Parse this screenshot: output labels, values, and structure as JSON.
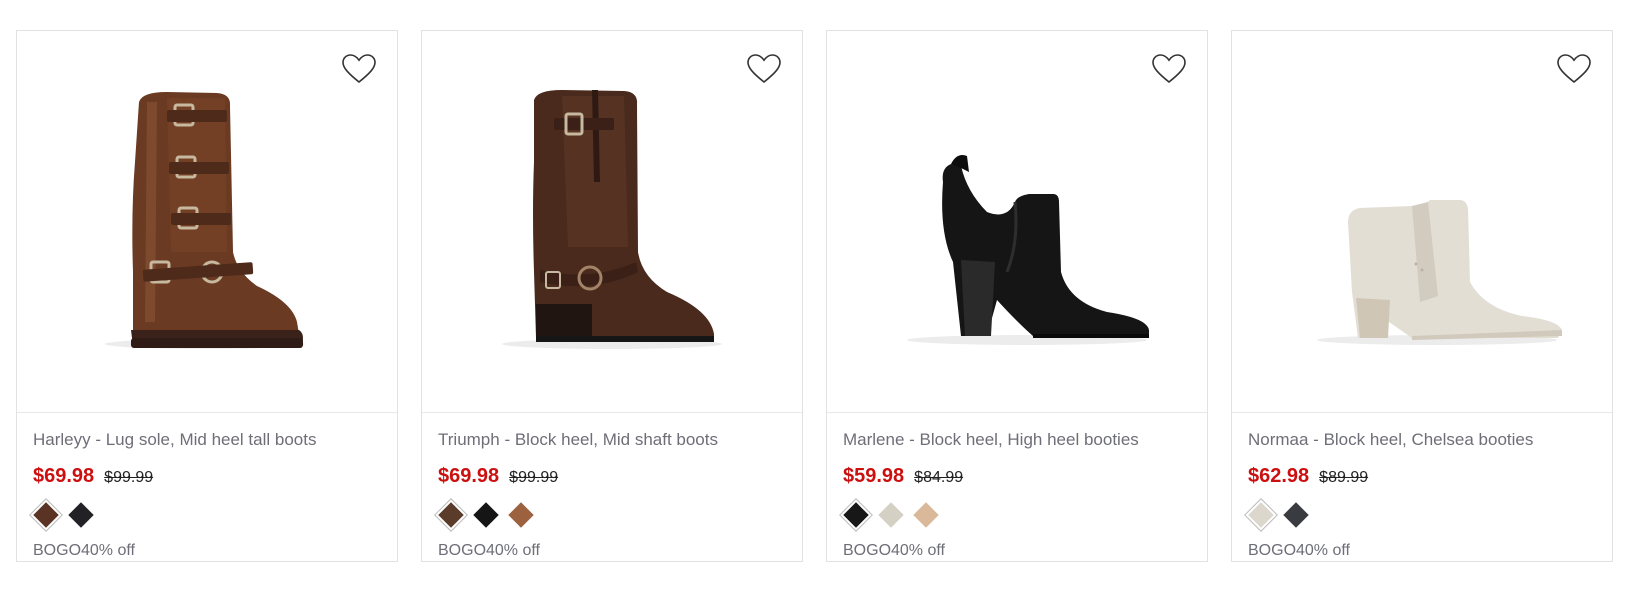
{
  "products": [
    {
      "name": "Harleyy - Lug sole, Mid heel tall boots",
      "sale_price": "$69.98",
      "original_price": "$99.99",
      "swatches": [
        "#5a3324",
        "#222226"
      ],
      "promo": "BOGO40% off",
      "image_icon": "tall-buckle-boot"
    },
    {
      "name": "Triumph - Block heel, Mid shaft boots",
      "sale_price": "$69.98",
      "original_price": "$99.99",
      "swatches": [
        "#5b3b2a",
        "#151515",
        "#9c6240"
      ],
      "promo": "BOGO40% off",
      "image_icon": "moto-boot"
    },
    {
      "name": "Marlene - Block heel, High heel booties",
      "sale_price": "$59.98",
      "original_price": "$84.99",
      "swatches": [
        "#171717",
        "#d5d0c4",
        "#d9b99a"
      ],
      "promo": "BOGO40% off",
      "image_icon": "black-bootie"
    },
    {
      "name": "Normaa - Block heel, Chelsea booties",
      "sale_price": "$62.98",
      "original_price": "$89.99",
      "swatches": [
        "#dcd7cd",
        "#3a3b40"
      ],
      "promo": "BOGO40% off",
      "image_icon": "chelsea-bootie"
    }
  ],
  "colors": {
    "sale": "#cc1010",
    "text_muted": "#6e6e78",
    "border": "#e2e2e2"
  }
}
